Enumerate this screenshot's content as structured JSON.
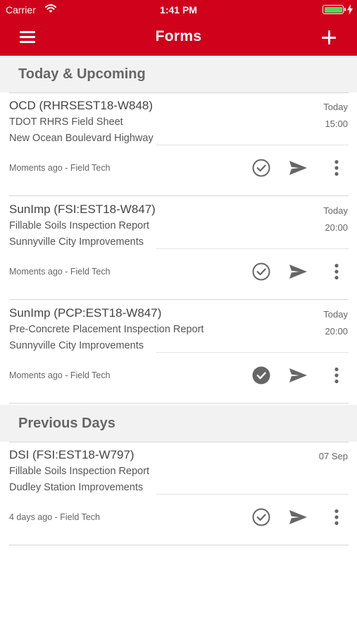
{
  "status_bar": {
    "carrier": "Carrier",
    "time": "1:41 PM",
    "battery_color": "#4cd964"
  },
  "header": {
    "title": "Forms",
    "background": "#d0021b",
    "menu_icon": "hamburger-menu-icon",
    "add_icon": "plus-icon"
  },
  "sections": [
    {
      "label": "Today & Upcoming",
      "forms": [
        {
          "title": "OCD (RHRSEST18-W848)",
          "subtitle": "TDOT RHRS Field Sheet",
          "project": "New Ocean Boulevard Highway",
          "date": "Today",
          "time": "15:00",
          "meta": "Moments ago - Field Tech",
          "completed": false
        },
        {
          "title": "SunImp (FSI:EST18-W847)",
          "subtitle": "Fillable Soils Inspection Report",
          "project": "Sunnyville City Improvements",
          "date": "Today",
          "time": "20:00",
          "meta": "Moments ago - Field Tech",
          "completed": false
        },
        {
          "title": "SunImp (PCP:EST18-W847)",
          "subtitle": "Pre-Concrete Placement Inspection Report",
          "project": "Sunnyville City Improvements",
          "date": "Today",
          "time": "20:00",
          "meta": "Moments ago - Field Tech",
          "completed": true
        }
      ]
    },
    {
      "label": "Previous Days",
      "forms": [
        {
          "title": "DSI (FSI:EST18-W797)",
          "subtitle": "Fillable Soils Inspection Report",
          "project": "Dudley Station Improvements",
          "date": "07 Sep",
          "time": "",
          "meta": "4 days ago - Field Tech",
          "completed": false
        }
      ]
    }
  ],
  "icons": {
    "check": "check-circle-icon",
    "send": "send-icon",
    "more": "more-vertical-icon"
  },
  "colors": {
    "icon": "#666666"
  }
}
